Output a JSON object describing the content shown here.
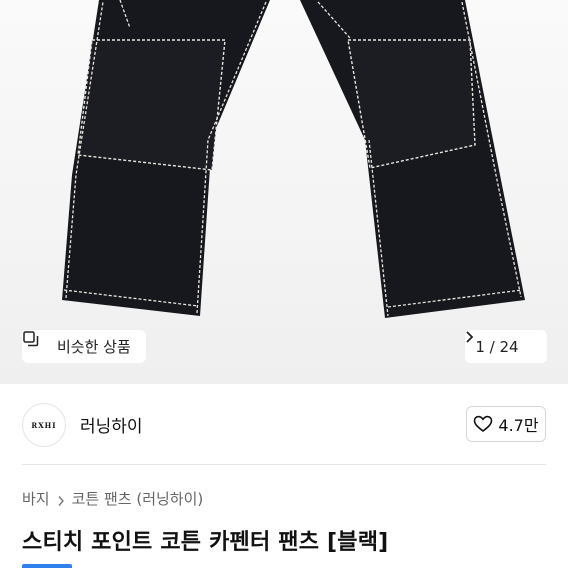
{
  "gallery": {
    "similar_label": "비슷한 상품",
    "counter": "1 / 24"
  },
  "brand": {
    "logo_text": "RXHI",
    "name": "러닝하이",
    "likes": "4.7만"
  },
  "breadcrumb": {
    "category": "바지",
    "subcategory": "코튼 팬츠 (러닝하이)"
  },
  "product": {
    "title": "스티치 포인트 코튼 카펜터 팬츠 [블랙]"
  },
  "colors": {
    "accent": "#2f80ed",
    "garment": "#16181d",
    "stitch": "#e8e6df"
  }
}
